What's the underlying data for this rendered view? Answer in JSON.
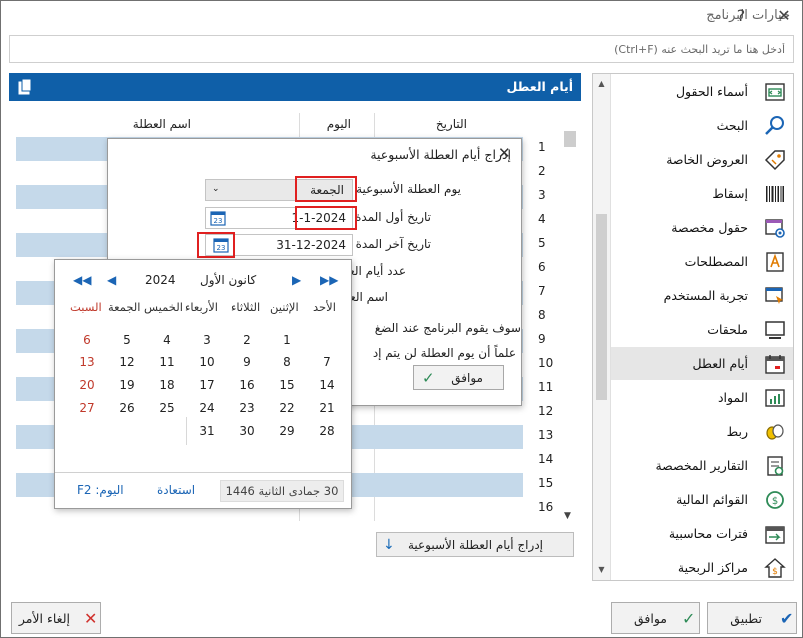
{
  "window": {
    "title": "خيارات البرنامج",
    "help": "?",
    "close": "✕"
  },
  "search": {
    "placeholder": "أدخل هنا ما تريد البحث عنه (Ctrl+F)"
  },
  "sidebar": {
    "items": [
      {
        "label": "أسماء الحقول",
        "icon": "field-names-icon"
      },
      {
        "label": "البحث",
        "icon": "search-icon"
      },
      {
        "label": "العروض الخاصة",
        "icon": "offers-tag-icon"
      },
      {
        "label": "إسقاط",
        "icon": "barcode-icon"
      },
      {
        "label": "حقول مخصصة",
        "icon": "custom-fields-icon"
      },
      {
        "label": "المصطلحات",
        "icon": "terms-icon"
      },
      {
        "label": "تجربة المستخدم",
        "icon": "user-experience-icon"
      },
      {
        "label": "ملحقات",
        "icon": "attachments-icon"
      },
      {
        "label": "أيام العطل",
        "icon": "holidays-calendar-icon"
      },
      {
        "label": "المواد",
        "icon": "materials-chart-icon"
      },
      {
        "label": "ربط",
        "icon": "link-icon"
      },
      {
        "label": "التقارير المخصصة",
        "icon": "custom-reports-icon"
      },
      {
        "label": "القوائم المالية",
        "icon": "financial-statements-icon"
      },
      {
        "label": "فترات محاسبية",
        "icon": "accounting-periods-icon"
      },
      {
        "label": "مراكز الربحية",
        "icon": "profit-centers-icon"
      }
    ],
    "active_index": 8
  },
  "panel": {
    "title": "أيام العطل",
    "columns": [
      "التاريخ",
      "اليوم",
      "اسم العطلة"
    ],
    "row_numbers": [
      "1",
      "2",
      "3",
      "4",
      "5",
      "6",
      "7",
      "8",
      "9",
      "10",
      "11",
      "12",
      "13",
      "14",
      "15",
      "16"
    ],
    "insert_button": "إدراج أيام العطلة الأسبوعية"
  },
  "buttons": {
    "cancel": "إلغاء الأمر",
    "ok": "موافق",
    "apply": "تطبيق"
  },
  "dialog": {
    "title": "إدراج أيام العطلة الأسبوعية",
    "weekly_day_label": "يوم العطلة الأسبوعية",
    "weekly_day_value": "الجمعة",
    "start_label": "تاريخ أول المدة",
    "start_value": "1-1-2024",
    "end_label": "تاريخ آخر المدة",
    "end_value": "31-12-2024",
    "days_count_label": "عدد أيام العطل",
    "holiday_name_label": "اسم العطلة",
    "note_line1": "سوف يقوم البرنامج عند الضغ",
    "note_line2": "علماً أن يوم العطلة لن يتم إد",
    "ok": "موافق"
  },
  "calendar": {
    "month": "كانون الأول",
    "year": "2024",
    "weekdays": [
      "الأحد",
      "الإثنين",
      "الثلاثاء",
      "الأربعاء",
      "الخميس",
      "الجمعة",
      "السبت"
    ],
    "weeks": [
      [
        "1",
        "2",
        "3",
        "4",
        "5",
        "",
        "6"
      ],
      [
        "7",
        "8",
        "9",
        "10",
        "11",
        "12",
        "13"
      ],
      [
        "14",
        "15",
        "16",
        "17",
        "18",
        "19",
        "20"
      ],
      [
        "21",
        "22",
        "23",
        "24",
        "25",
        "26",
        "27"
      ],
      [
        "28",
        "29",
        "30",
        "31",
        "",
        "",
        ""
      ]
    ],
    "hijri": "30 جمادى الثانية 1446",
    "restore": "استعادة",
    "today": "اليوم: F2",
    "weekend_color": "#c0392b"
  },
  "colors": {
    "accent": "#0f5fa8",
    "row_alt": "#c5d9ea",
    "highlight_border": "#e02020"
  }
}
